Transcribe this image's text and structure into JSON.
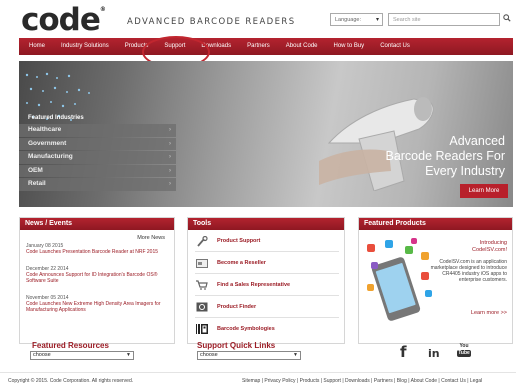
{
  "header": {
    "logo": "code",
    "tagline": "ADVANCED BARCODE READERS",
    "language_placeholder": "Language:",
    "search_placeholder": "Search site"
  },
  "nav": {
    "items": [
      "Home",
      "Industry Solutions",
      "Products",
      "Support",
      "Downloads",
      "Partners",
      "About Code",
      "How to Buy",
      "Contact Us"
    ]
  },
  "hero": {
    "featured_label": "Featured Industries",
    "industries": [
      "Healthcare",
      "Government",
      "Manufacturing",
      "OEM",
      "Retail"
    ],
    "headline_lines": [
      "Advanced",
      "Barcode Readers For",
      "Every Industry"
    ],
    "button_label": "Learn More"
  },
  "news": {
    "title": "News / Events",
    "more_label": "More News",
    "items": [
      {
        "date": "January 08 2015",
        "text": "Code Launches Presentation Barcode Reader at NRF 2015"
      },
      {
        "date": "December 22 2014",
        "text": "Code Announces Support for ID Integration's Barcode OS® Software Suite"
      },
      {
        "date": "November 05 2014",
        "text": "Code Launches New Extreme High Density Area Imagers for Manufacturing Applications"
      }
    ]
  },
  "tools": {
    "title": "Tools",
    "items": [
      {
        "label": "Product Support",
        "icon": "wrench-icon"
      },
      {
        "label": "Become a Reseller",
        "icon": "card-icon"
      },
      {
        "label": "Find a Sales Representative",
        "icon": "cart-icon"
      },
      {
        "label": "Product Finder",
        "icon": "magnifier-icon"
      },
      {
        "label": "Barcode Symbologies",
        "icon": "barcode-icon"
      }
    ]
  },
  "featured": {
    "title": "Featured Products",
    "headline_lines": [
      "Introducing",
      "CodeISV.com!"
    ],
    "body": "CodeISV.com is an application marketplace designed to introduce CR4405 industry iOS apps to enterprise customers.",
    "more_label": "Learn more >>"
  },
  "resources": {
    "title": "Featured Resources",
    "select_value": "choose"
  },
  "support_links": {
    "title": "Support Quick Links",
    "select_value": "choose"
  },
  "social": {
    "facebook": "f",
    "linkedin": "in",
    "youtube_top": "You",
    "youtube_bottom": "Tube"
  },
  "footer": {
    "copyright": "Copyright © 2015. Code Corporation. All rights reserved.",
    "links": "Sitemap | Privacy Policy | Products | Support | Downloads | Partners | Blog | About Code | Contact Us | Legal"
  },
  "colors": {
    "brand_red": "#b3232f",
    "link_red": "#9b1c25"
  }
}
